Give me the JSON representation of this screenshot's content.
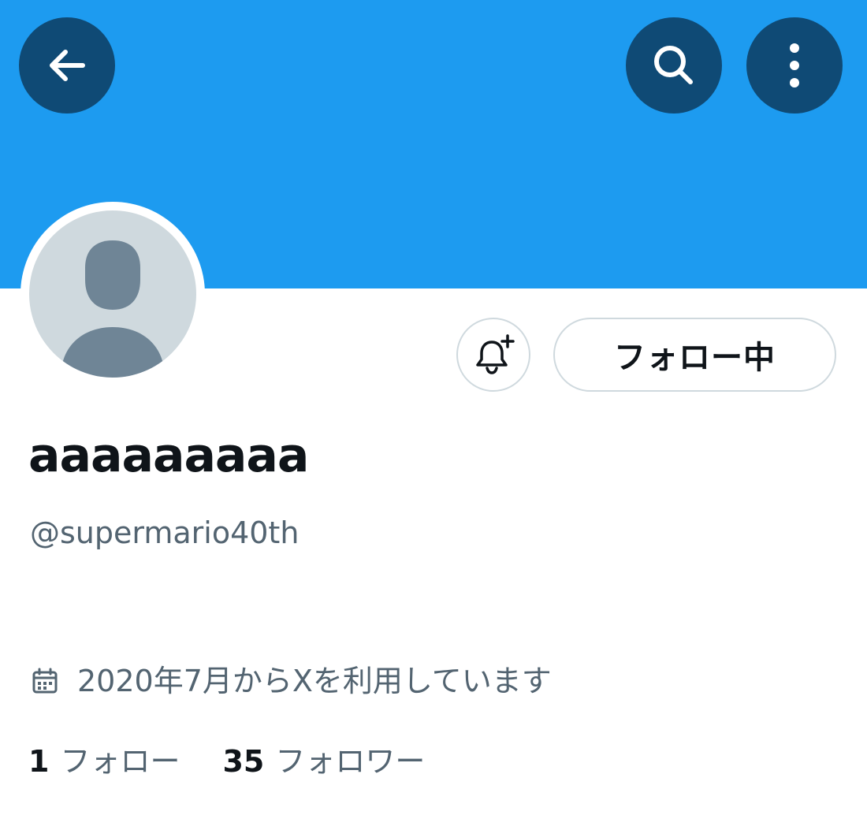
{
  "banner": {
    "color": "#1d9bf0"
  },
  "header_buttons": {
    "back_icon": "arrow-left-icon",
    "search_icon": "search-icon",
    "more_icon": "more-vertical-icon",
    "button_color": "#0f4a75"
  },
  "profile": {
    "avatar_icon": "default-avatar-icon",
    "display_name": "aaaaaaaaa",
    "handle": "@supermario40th",
    "joined_icon": "calendar-icon",
    "joined_text": "2020年7月からXを利用しています"
  },
  "actions": {
    "notify_icon": "bell-plus-icon",
    "follow_label": "フォロー中"
  },
  "stats": {
    "following_count": "1",
    "following_label": "フォロー",
    "followers_count": "35",
    "followers_label": "フォロワー"
  }
}
